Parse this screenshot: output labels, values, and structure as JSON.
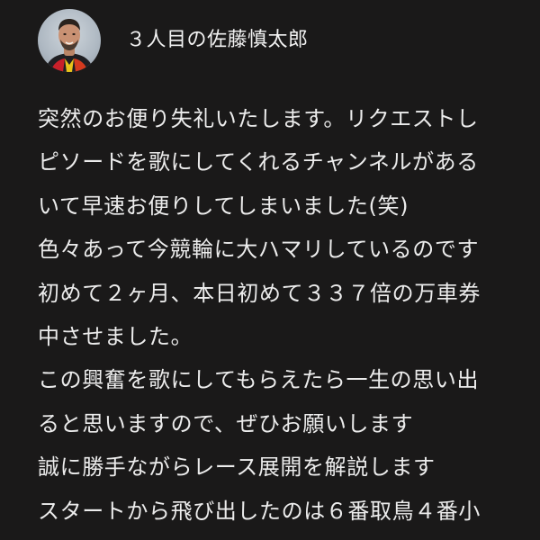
{
  "comment": {
    "author": "３人目の佐藤慎太郎",
    "avatar_icon": "user-avatar-photo",
    "lines": [
      "突然のお便り失礼いたします。リクエストし",
      "ピソードを歌にしてくれるチャンネルがある",
      "いて早速お便りしてしまいました(笑)",
      "色々あって今競輪に大ハマリしているのです",
      "初めて２ヶ月、本日初めて３３７倍の万車券",
      "中させました。",
      "この興奮を歌にしてもらえたら一生の思い出",
      "ると思いますので、ぜひお願いします",
      "誠に勝手ながらレース展開を解説します",
      "スタートから飛び出したのは６番取鳥４番小"
    ]
  }
}
